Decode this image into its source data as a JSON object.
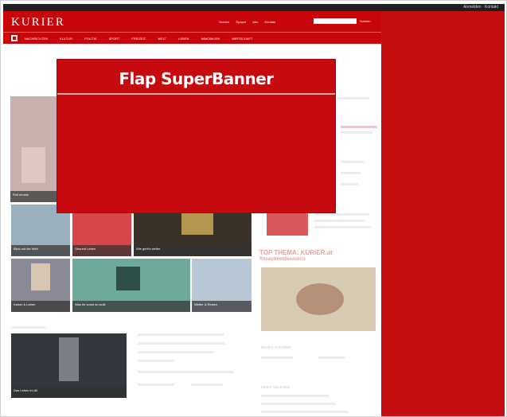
{
  "top_strip": {
    "links": "Anmelden · Kontakt"
  },
  "header": {
    "logo": "KURIER",
    "links": [
      "Service",
      "Epaper",
      "Abo",
      "Kontakt"
    ],
    "search_placeholder": "",
    "search_button": "Suchen"
  },
  "nav": {
    "items": [
      "NACHRICHTEN",
      "KULTUR",
      "POLITIK",
      "SPORT",
      "FREIZEIT",
      "WELT",
      "LEBEN",
      "IMMOBILIEN",
      "WIRTSCHAFT"
    ]
  },
  "ad": {
    "title": "Flap SuperBanner"
  },
  "content": {
    "lead_caption": "Roll neuste",
    "tiles": [
      "Blick auf die Welt",
      "Gesund Leben",
      "Wie geht's weiter",
      "Kaiser & Leben",
      "Was ihr sonst so wollt",
      "Wetter & Reisen"
    ],
    "side_heading": "TOP THEMA: KURIER.at",
    "side_subheading": "Rezeptmeldiesestrix",
    "bottom_caption": "Das Leben im All",
    "bottom_section_labels": [
      "NEUES AUS DEM",
      "MEIST GELESEN"
    ]
  },
  "colors": {
    "brand_red": "#c7050b",
    "ad_red": "#c70910",
    "right_panel_red": "#c40e12"
  }
}
